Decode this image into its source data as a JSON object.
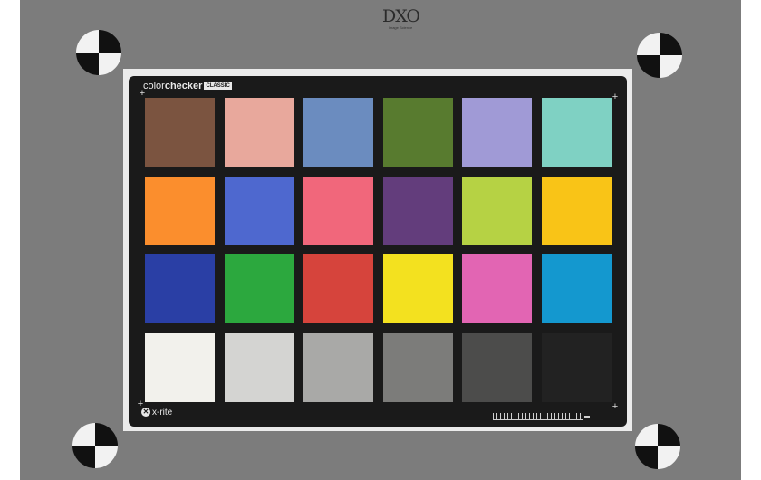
{
  "logo": {
    "mark": "DXO",
    "sub": "Image Science",
    "name": "dxo-logo"
  },
  "card": {
    "brand_light": "color",
    "brand_bold": "checker",
    "brand_tag": "CLASSIC",
    "maker": "x-rite"
  },
  "patches": [
    {
      "name": "dark-skin",
      "color": "#7b5440"
    },
    {
      "name": "light-skin",
      "color": "#e8a89c"
    },
    {
      "name": "blue-sky",
      "color": "#6b8cbf"
    },
    {
      "name": "foliage",
      "color": "#587b2f"
    },
    {
      "name": "blue-flower",
      "color": "#a09ad6"
    },
    {
      "name": "bluish-green",
      "color": "#7fd1c3"
    },
    {
      "name": "orange",
      "color": "#fb8e2d"
    },
    {
      "name": "purplish-blue",
      "color": "#4e68cf"
    },
    {
      "name": "moderate-red",
      "color": "#f1677b"
    },
    {
      "name": "purple",
      "color": "#633d7c"
    },
    {
      "name": "yellow-green",
      "color": "#b6d244"
    },
    {
      "name": "orange-yellow",
      "color": "#f9c417"
    },
    {
      "name": "blue",
      "color": "#2a3fa5"
    },
    {
      "name": "green",
      "color": "#2ca83e"
    },
    {
      "name": "red",
      "color": "#d6443c"
    },
    {
      "name": "yellow",
      "color": "#f3e11f"
    },
    {
      "name": "magenta",
      "color": "#e265b3"
    },
    {
      "name": "cyan",
      "color": "#1498cf"
    },
    {
      "name": "white",
      "color": "#f2f1ec"
    },
    {
      "name": "neutral-8",
      "color": "#d4d4d2"
    },
    {
      "name": "neutral-6-5",
      "color": "#a9a9a7"
    },
    {
      "name": "neutral-5",
      "color": "#7c7c7a"
    },
    {
      "name": "neutral-3-5",
      "color": "#4c4c4b"
    },
    {
      "name": "black",
      "color": "#222222"
    }
  ]
}
